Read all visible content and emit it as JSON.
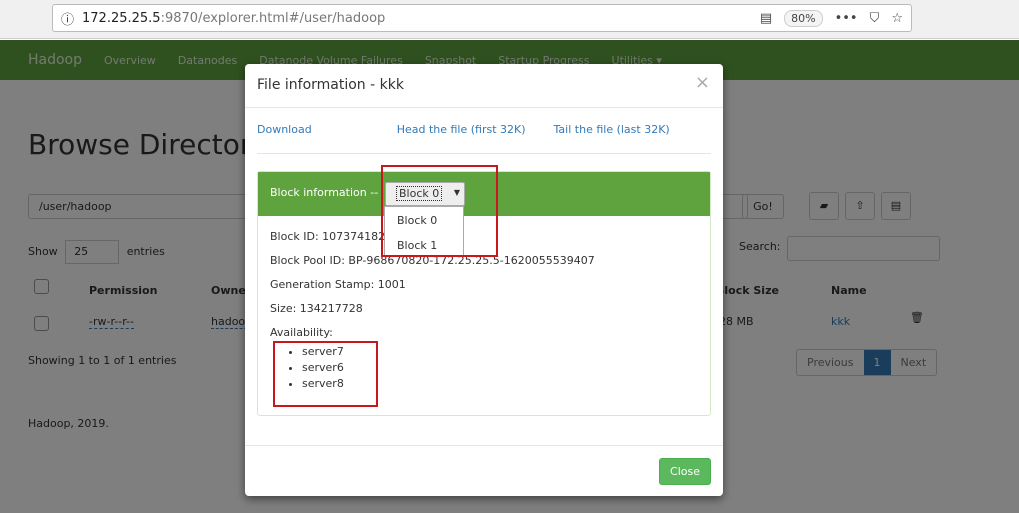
{
  "browser": {
    "url_host": "172.25.25.5",
    "url_rest": ":9870/explorer.html#/user/hadoop",
    "zoom": "80%"
  },
  "nav": {
    "brand": "Hadoop",
    "items": [
      "Overview",
      "Datanodes",
      "Datanode Volume Failures",
      "Snapshot",
      "Startup Progress",
      "Utilities ▾"
    ]
  },
  "page": {
    "title": "Browse Directory",
    "path": "/user/hadoop",
    "go": "Go!",
    "show": "Show",
    "entries_count": "25",
    "entries": "entries",
    "search": "Search:",
    "columns": [
      "Permission",
      "Owner",
      "Block Size",
      "Name"
    ],
    "row": {
      "permission": "-rw-r--r--",
      "owner": "hadoop",
      "block_size": "128 MB",
      "name": "kkk"
    },
    "showing": "Showing 1 to 1 of 1 entries",
    "previous": "Previous",
    "page": "1",
    "next": "Next",
    "footer": "Hadoop, 2019."
  },
  "modal": {
    "title": "File information - kkk",
    "close_x": "×",
    "download": "Download",
    "head": "Head the file (first 32K)",
    "tail": "Tail the file (last 32K)",
    "block_info_label": "Block information --",
    "selected_block": "Block 0",
    "block_options": [
      "Block 0",
      "Block 1"
    ],
    "block_id": "Block ID: 1073741825",
    "block_pool": "Block Pool ID: BP-968670820-172.25.25.5-1620055539407",
    "gen_stamp": "Generation Stamp: 1001",
    "size": "Size: 134217728",
    "availability": "Availability:",
    "servers": [
      "server7",
      "server6",
      "server8"
    ],
    "close": "Close"
  },
  "colors": {
    "nav": "#5ea33e",
    "close": "#5cb85c",
    "highlight": "#c8181e"
  }
}
